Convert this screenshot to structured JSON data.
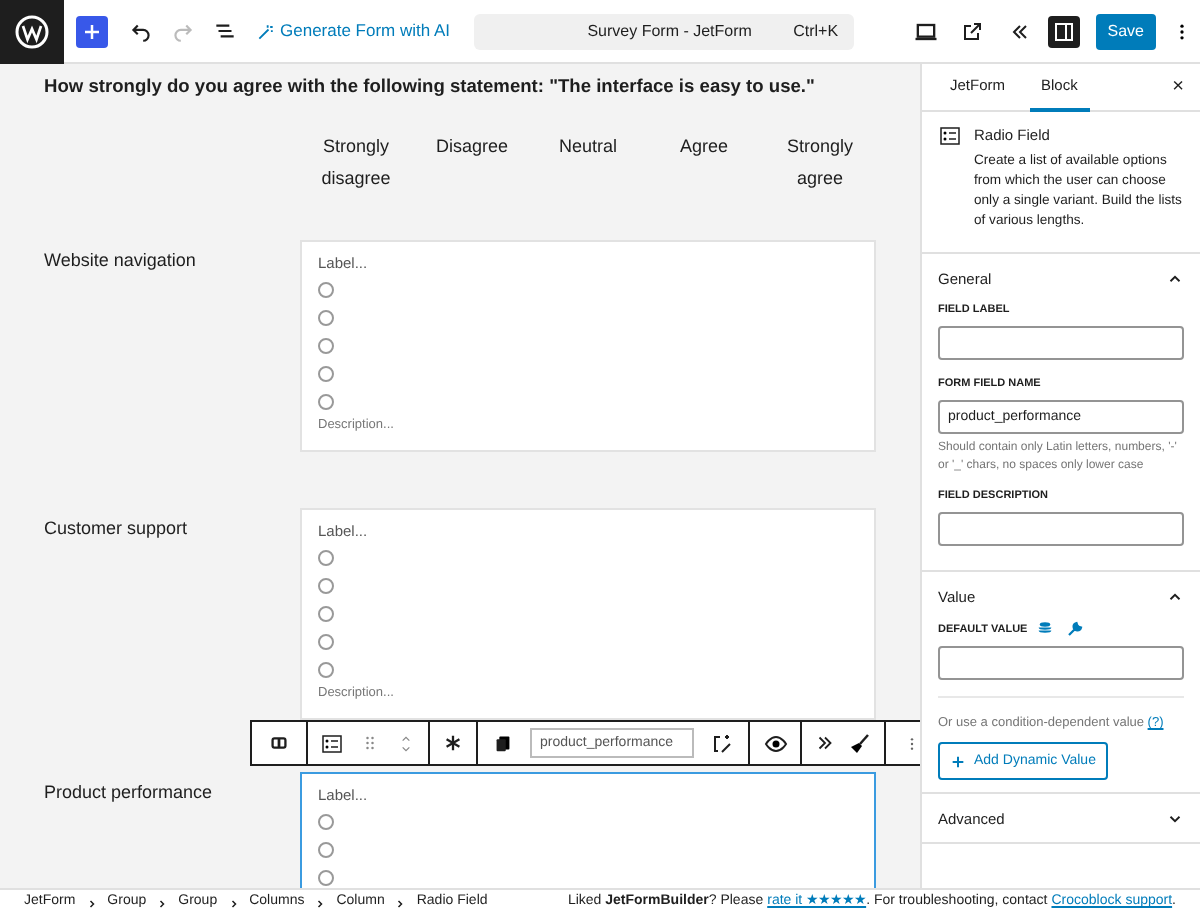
{
  "topbar": {
    "ai_button": "Generate Form with AI",
    "document_title": "Survey Form - JetForm",
    "shortcut": "Ctrl+K",
    "save": "Save",
    "sidebar_open": true
  },
  "canvas": {
    "question": "How strongly do you agree with the following statement: \"The interface is easy to use.\"",
    "scale": [
      "Strongly disagree",
      "Disagree",
      "Neutral",
      "Agree",
      "Strongly agree"
    ],
    "rows": [
      {
        "label": "Website navigation",
        "field_label": "Label...",
        "options": [
          {
            "checked": false
          },
          {
            "checked": false
          },
          {
            "checked": false
          },
          {
            "checked": false
          },
          {
            "checked": false
          }
        ],
        "description": "Description...",
        "selected": false
      },
      {
        "label": "Customer support",
        "field_label": "Label...",
        "options": [
          {
            "checked": false
          },
          {
            "checked": false
          },
          {
            "checked": false
          },
          {
            "checked": false
          },
          {
            "checked": false
          }
        ],
        "description": "Description...",
        "selected": false
      },
      {
        "label": "Product performance",
        "field_label": "Label...",
        "options": [
          {
            "checked": false
          },
          {
            "checked": false
          },
          {
            "checked": false
          }
        ],
        "selected": true
      }
    ],
    "block_toolbar": {
      "field_name": "product_performance"
    }
  },
  "sidebar": {
    "tabs": [
      {
        "label": "JetForm",
        "selected": false
      },
      {
        "label": "Block",
        "selected": true
      }
    ],
    "close": "×",
    "block": {
      "title": "Radio Field",
      "description": "Create a list of available options from which the user can choose only a single variant. Build the lists of various lengths."
    },
    "sections": [
      {
        "kind": "general",
        "title": "General",
        "expanded": true,
        "field_label": "FIELD LABEL",
        "form_field_name": "FORM FIELD NAME",
        "form_field_name_value": "product_performance",
        "hint": "Should contain only Latin letters, numbers, '-' or '_' chars, no spaces only lower case",
        "field_description": "FIELD DESCRIPTION"
      },
      {
        "kind": "value",
        "title": "Value",
        "expanded": true,
        "default_value": "DEFAULT VALUE",
        "condition_text": "Or use a condition-dependent value",
        "help": "(?)",
        "button": "Add Dynamic Value"
      },
      {
        "kind": "advanced",
        "title": "Advanced",
        "expanded": false
      }
    ]
  },
  "footer": {
    "breadcrumbs": [
      "JetForm",
      "Group",
      "Group",
      "Columns",
      "Column",
      "Radio Field"
    ],
    "notice": "Liked **JetFormBuilder**? Please",
    "rate_link": "rate it ★★★★★",
    "notice_2": ". For troubleshooting, contact",
    "support_link": "Crocoblock support",
    "notice_end": "."
  }
}
